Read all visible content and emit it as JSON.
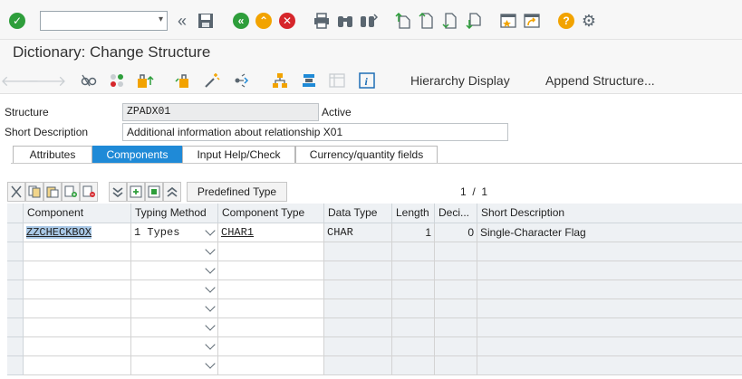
{
  "toolbar": {
    "command_field_value": "",
    "icons": [
      "check-icon",
      "command-field",
      "back-double-icon",
      "save-icon",
      "back-icon",
      "exit-icon",
      "cancel-icon",
      "print-icon",
      "find-icon",
      "find-next-icon",
      "first-page-icon",
      "prev-page-icon",
      "next-page-icon",
      "last-page-icon",
      "new-session-icon",
      "shortcut-icon",
      "help-icon",
      "settings-icon"
    ]
  },
  "title": "Dictionary: Change Structure",
  "app_toolbar": {
    "hierarchy_display": "Hierarchy Display",
    "append_structure": "Append Structure..."
  },
  "header": {
    "structure_label": "Structure",
    "structure_value": "ZPADX01",
    "status": "Active",
    "short_desc_label": "Short Description",
    "short_desc_value": "Additional information about relationship X01"
  },
  "tabs": {
    "attributes": "Attributes",
    "components": "Components",
    "input_help": "Input Help/Check",
    "currency": "Currency/quantity fields"
  },
  "grid_toolbar": {
    "predefined_type": "Predefined Type",
    "page_indicator": "1  /  1"
  },
  "columns": {
    "component": "Component",
    "typing_method": "Typing Method",
    "component_type": "Component Type",
    "data_type": "Data Type",
    "length": "Length",
    "decimals": "Deci...",
    "short_description": "Short Description"
  },
  "rows": [
    {
      "component": "ZZCHECKBOX",
      "typing_method": "1 Types",
      "component_type": "CHAR1",
      "data_type": "CHAR",
      "length": "1",
      "decimals": "0",
      "short_description": "Single-Character Flag"
    }
  ],
  "colors": {
    "accent": "#1f8ad7",
    "green": "#2e9e3b",
    "orange": "#f2a300",
    "red": "#d6262b"
  }
}
